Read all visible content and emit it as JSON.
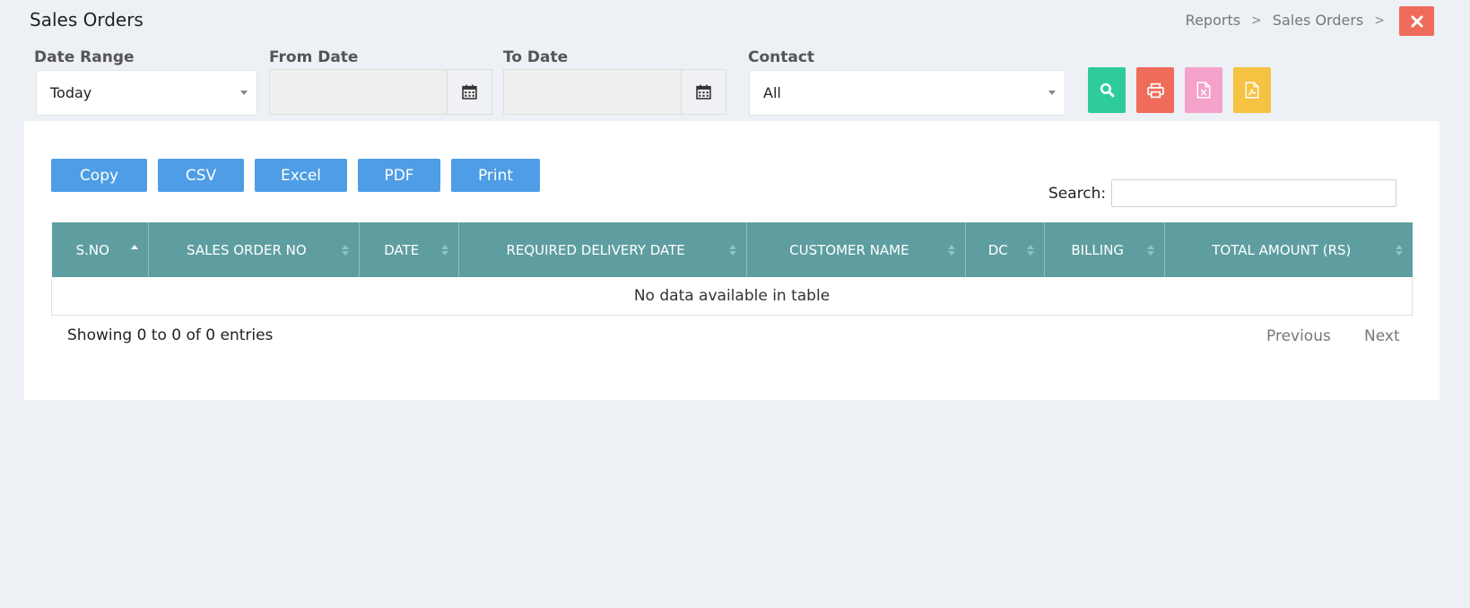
{
  "header": {
    "title": "Sales Orders",
    "breadcrumb": [
      "Reports",
      "Sales Orders"
    ],
    "breadcrumb_separator": ">"
  },
  "filters": {
    "date_range": {
      "label": "Date Range",
      "value": "Today"
    },
    "from_date": {
      "label": "From Date",
      "value": ""
    },
    "to_date": {
      "label": "To Date",
      "value": ""
    },
    "contact": {
      "label": "Contact",
      "value": "All"
    }
  },
  "action_buttons": [
    {
      "icon": "search-icon",
      "color": "#2ecc9a"
    },
    {
      "icon": "print-icon",
      "color": "#ef6b5a"
    },
    {
      "icon": "excel-file-icon",
      "color": "#f4a2c9"
    },
    {
      "icon": "pdf-file-icon",
      "color": "#f5c242"
    }
  ],
  "export": {
    "copy": "Copy",
    "csv": "CSV",
    "excel": "Excel",
    "pdf": "PDF",
    "print": "Print"
  },
  "search": {
    "label": "Search:",
    "value": ""
  },
  "table": {
    "columns": [
      "S.NO",
      "SALES ORDER NO",
      "DATE",
      "REQUIRED DELIVERY DATE",
      "CUSTOMER NAME",
      "DC",
      "BILLING",
      "TOTAL AMOUNT (RS)"
    ],
    "empty_message": "No data available in table",
    "header_color": "#5f9ea0"
  },
  "footer": {
    "info": "Showing 0 to 0 of 0 entries",
    "previous": "Previous",
    "next": "Next"
  }
}
